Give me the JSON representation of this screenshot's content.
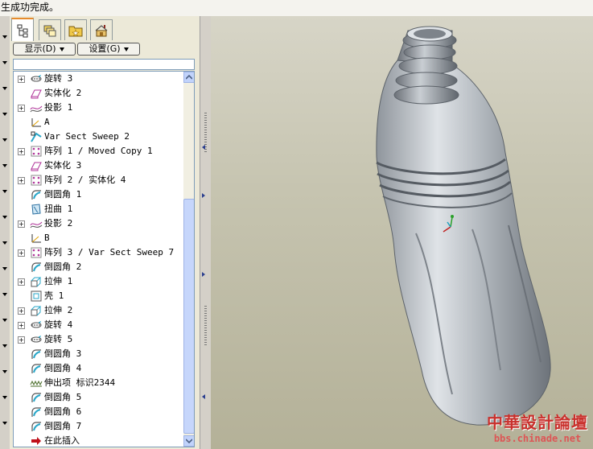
{
  "status_message": "生成功完成。",
  "tabs": [
    {
      "name": "model-tree",
      "icon": "model-tree-icon"
    },
    {
      "name": "layers",
      "icon": "layers-icon"
    },
    {
      "name": "favorites",
      "icon": "folder-star-icon"
    },
    {
      "name": "connections",
      "icon": "connections-icon"
    }
  ],
  "toolbar": {
    "show_label": "显示(D)",
    "settings_label": "设置(G)"
  },
  "tree": {
    "items": [
      {
        "label": "旋转 3",
        "icon": "revolve-icon",
        "expand": "+"
      },
      {
        "label": "实体化 2",
        "icon": "solidify-icon",
        "expand": ""
      },
      {
        "label": "投影 1",
        "icon": "projection-icon",
        "expand": "+"
      },
      {
        "label": "A",
        "icon": "coordinate-system-icon",
        "expand": ""
      },
      {
        "label": "Var Sect Sweep 2",
        "icon": "sweep-icon",
        "expand": ""
      },
      {
        "label": "阵列 1 / Moved Copy 1",
        "icon": "pattern-icon",
        "expand": "+"
      },
      {
        "label": "实体化 3",
        "icon": "solidify-icon",
        "expand": ""
      },
      {
        "label": "阵列 2 / 实体化 4",
        "icon": "pattern-icon",
        "expand": "+"
      },
      {
        "label": "倒圆角 1",
        "icon": "round-icon",
        "expand": ""
      },
      {
        "label": "扭曲 1",
        "icon": "warp-icon",
        "expand": ""
      },
      {
        "label": "投影 2",
        "icon": "projection-icon",
        "expand": "+"
      },
      {
        "label": "B",
        "icon": "coordinate-system-icon",
        "expand": ""
      },
      {
        "label": "阵列 3 / Var Sect Sweep 7",
        "icon": "pattern-icon",
        "expand": "+"
      },
      {
        "label": "倒圆角 2",
        "icon": "round-icon",
        "expand": ""
      },
      {
        "label": "拉伸 1",
        "icon": "extrude-icon",
        "expand": "+"
      },
      {
        "label": "壳 1",
        "icon": "shell-icon",
        "expand": ""
      },
      {
        "label": "拉伸 2",
        "icon": "extrude-icon",
        "expand": "+"
      },
      {
        "label": "旋转 4",
        "icon": "revolve-icon",
        "expand": "+"
      },
      {
        "label": "旋转 5",
        "icon": "revolve-icon",
        "expand": "+"
      },
      {
        "label": "倒圆角 3",
        "icon": "round-icon",
        "expand": ""
      },
      {
        "label": "倒圆角 4",
        "icon": "round-icon",
        "expand": ""
      },
      {
        "label": "伸出项 标识2344",
        "icon": "protrusion-icon",
        "expand": ""
      },
      {
        "label": "倒圆角 5",
        "icon": "round-icon",
        "expand": ""
      },
      {
        "label": "倒圆角 6",
        "icon": "round-icon",
        "expand": ""
      },
      {
        "label": "倒圆角 7",
        "icon": "round-icon",
        "expand": ""
      },
      {
        "label": "在此插入",
        "icon": "insert-here-arrow-icon",
        "expand": ""
      }
    ]
  },
  "watermark": {
    "line1": "中華設計論壇",
    "line2": "bbs.chinade.net"
  },
  "colors": {
    "accent_tab": "#e68b2c",
    "icon_cyan": "#2aa7c9",
    "icon_magenta": "#b0359a",
    "insert_arrow": "#c0101a",
    "viewport_bg": "#c6c4b0"
  }
}
